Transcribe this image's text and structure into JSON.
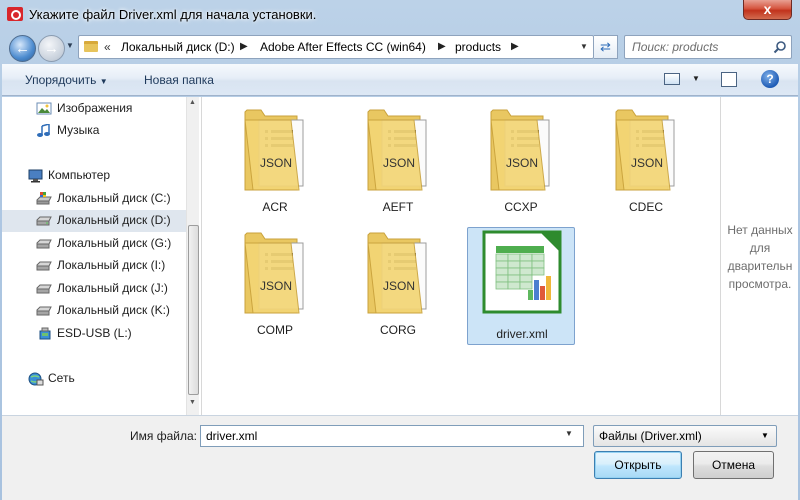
{
  "window": {
    "title": "Укажите файл Driver.xml для начала установки.",
    "close_glyph": "x"
  },
  "nav": {
    "address_chevrons": "«",
    "breadcrumbs": [
      "Локальный диск (D:)",
      "Adobe After Effects CC (win64)",
      "products"
    ],
    "search_placeholder": "Поиск: products"
  },
  "toolbar": {
    "organize_label": "Упорядочить",
    "new_folder_label": "Новая папка",
    "help_label": "?"
  },
  "sidebar": {
    "items": [
      {
        "label": "Изображения",
        "icon": "pictures-icon"
      },
      {
        "label": "Музыка",
        "icon": "music-icon"
      },
      {
        "label": "Компьютер",
        "icon": "computer-icon"
      },
      {
        "label": "Локальный диск (C:)",
        "icon": "system-drive-icon"
      },
      {
        "label": "Локальный диск (D:)",
        "icon": "drive-icon",
        "selected": true
      },
      {
        "label": "Локальный диск (G:)",
        "icon": "drive-icon"
      },
      {
        "label": "Локальный диск (I:)",
        "icon": "drive-icon"
      },
      {
        "label": "Локальный диск (J:)",
        "icon": "drive-icon"
      },
      {
        "label": "Локальный диск (K:)",
        "icon": "drive-icon"
      },
      {
        "label": "ESD-USB (L:)",
        "icon": "usb-drive-icon"
      },
      {
        "label": "Сеть",
        "icon": "network-icon"
      }
    ]
  },
  "files": [
    {
      "name": "ACR",
      "type": "folder",
      "badge": "JSON"
    },
    {
      "name": "AEFT",
      "type": "folder",
      "badge": "JSON"
    },
    {
      "name": "CCXP",
      "type": "folder",
      "badge": "JSON"
    },
    {
      "name": "CDEC",
      "type": "folder",
      "badge": "JSON"
    },
    {
      "name": "COMP",
      "type": "folder",
      "badge": "JSON"
    },
    {
      "name": "CORG",
      "type": "folder",
      "badge": "JSON"
    },
    {
      "name": "driver.xml",
      "type": "spreadsheet",
      "selected": true
    }
  ],
  "preview": {
    "line1": "Нет данных",
    "line2": "для",
    "line3": "дварительн",
    "line4": "просмотра."
  },
  "bottom": {
    "filename_label": "Имя файла:",
    "filename_value": "driver.xml",
    "filter_value": "Файлы (Driver.xml)",
    "open_label": "Открыть",
    "cancel_label": "Отмена"
  },
  "colors": {
    "selection": "#cce4f7",
    "selection_border": "#7da2ce",
    "folder": "#e7c45c",
    "spreadsheet_green": "#2e8b2e"
  }
}
